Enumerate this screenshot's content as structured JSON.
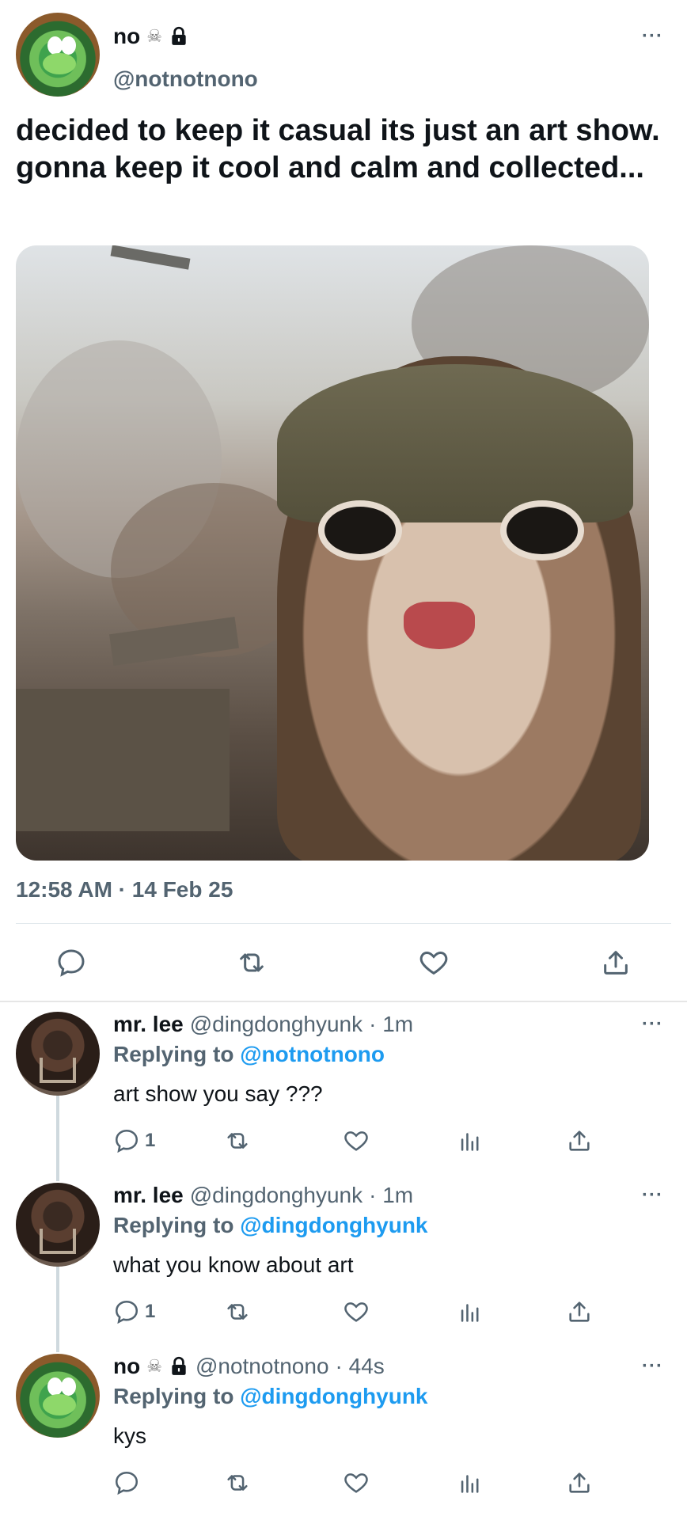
{
  "main_tweet": {
    "display_name": "no",
    "handle": "@notnotnono",
    "text": "decided to keep it casual its just an art show. gonna keep it cool and calm and collected...",
    "timestamp": "12:58 AM · 14 Feb 25",
    "more_label": "···",
    "badges": [
      "skull-crossbones-emoji",
      "lock-icon"
    ]
  },
  "replies": [
    {
      "display_name": "mr. lee",
      "handle": "@dingdonghyunk",
      "time": "· 1m",
      "replying_prefix": "Replying to",
      "replying_to": "@notnotnono",
      "text": "art show you say ???",
      "reply_count": "1",
      "more_label": "···"
    },
    {
      "display_name": "mr. lee",
      "handle": "@dingdonghyunk",
      "time": "· 1m",
      "replying_prefix": "Replying to",
      "replying_to": "@dingdonghyunk",
      "text": "what you know about art",
      "reply_count": "1",
      "more_label": "···"
    },
    {
      "display_name": "no",
      "handle": "@notnotnono",
      "time": "· 44s",
      "replying_prefix": "Replying to",
      "replying_to": "@dingdonghyunk",
      "text": "kys",
      "reply_count": "",
      "more_label": "···"
    }
  ],
  "icons": {
    "skull": "☠",
    "colors": {
      "mention": "#1d9bf0",
      "secondary": "#536471",
      "text": "#0f1419"
    }
  }
}
